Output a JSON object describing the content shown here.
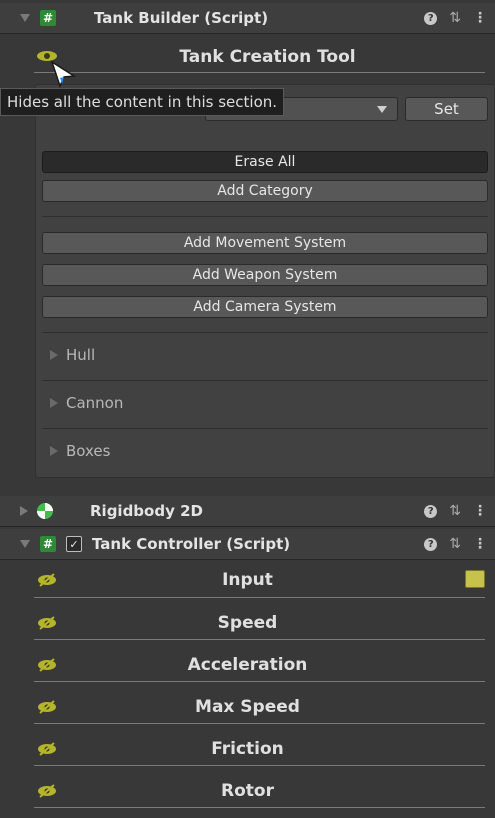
{
  "tank_builder": {
    "title": "Tank Builder (Script)",
    "section_title": "Tank Creation Tool",
    "tooltip": "Hides all the content in this section.",
    "set_label": "Set",
    "buttons": [
      "Erase All",
      "Add Category",
      "Add Movement System",
      "Add Weapon System",
      "Add Camera System"
    ],
    "foldouts": [
      "Hull",
      "Cannon",
      "Boxes"
    ]
  },
  "rigidbody": {
    "title": "Rigidbody 2D"
  },
  "tank_controller": {
    "title": "Tank Controller (Script)",
    "sections": [
      "Input",
      "Speed",
      "Acceleration",
      "Max Speed",
      "Friction",
      "Rotor"
    ]
  },
  "icons": {
    "help": "help-icon",
    "preset": "preset-icon",
    "menu": "kebab-menu-icon"
  },
  "colors": {
    "background": "#383838",
    "eye_icon": "#b5b52a",
    "script_icon": "#2f8a36"
  }
}
